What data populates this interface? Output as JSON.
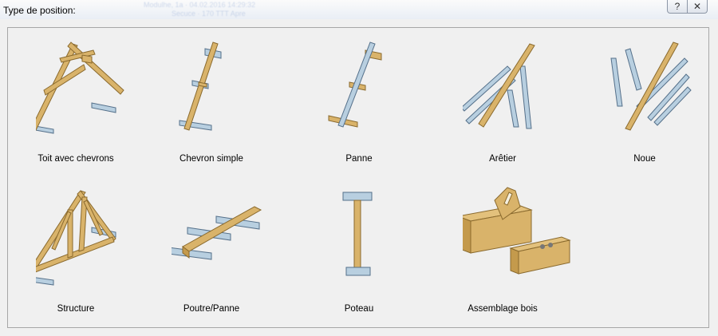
{
  "window": {
    "title": "Type de position:",
    "help_symbol": "?",
    "close_symbol": "✕",
    "ghost_line1": "Modulhe, 1a     ·  04.02.2016  14:29:32",
    "ghost_line2": "Secuce      · 170  TTT  Apre"
  },
  "items": [
    {
      "label": "Toit avec chevrons",
      "icon": "rafter-roof-icon"
    },
    {
      "label": "Chevron simple",
      "icon": "single-rafter-icon"
    },
    {
      "label": "Panne",
      "icon": "purlin-icon"
    },
    {
      "label": "Arêtier",
      "icon": "hip-rafter-icon"
    },
    {
      "label": "Noue",
      "icon": "valley-rafter-icon"
    },
    {
      "label": "Structure",
      "icon": "truss-structure-icon"
    },
    {
      "label": "Poutre/Panne",
      "icon": "beam-purlin-icon"
    },
    {
      "label": "Poteau",
      "icon": "post-icon"
    },
    {
      "label": "Assemblage bois",
      "icon": "timber-joint-icon"
    }
  ],
  "colors": {
    "wood_face": "#d9b36a",
    "wood_edge": "#8a6a2e",
    "steel_face": "#b8cfe0",
    "steel_edge": "#55708a"
  }
}
